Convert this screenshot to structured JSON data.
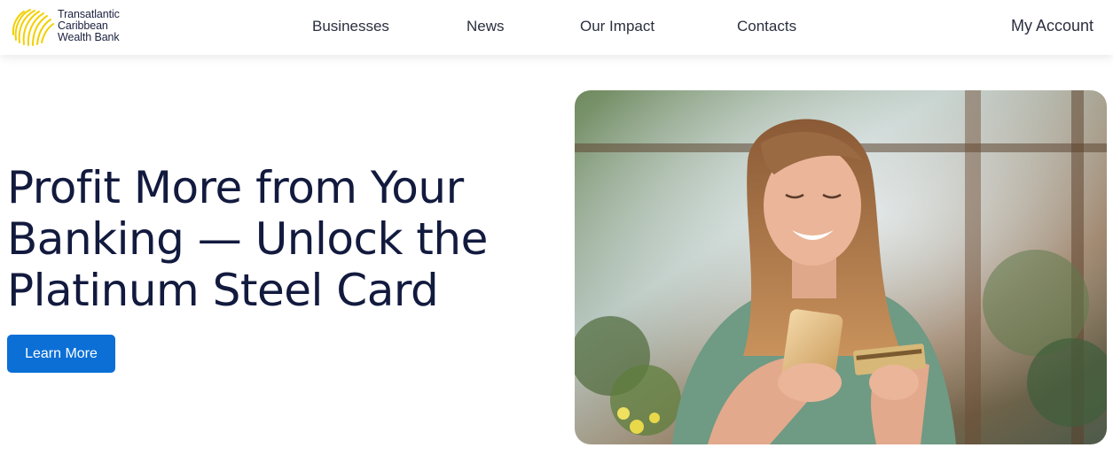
{
  "brand": {
    "name_line1": "Transatlantic",
    "name_line2": "Caribbean",
    "name_line3": "Wealth Bank",
    "logo_color": "#f2d000"
  },
  "nav": {
    "items": [
      {
        "label": "Businesses"
      },
      {
        "label": "News"
      },
      {
        "label": "Our Impact"
      },
      {
        "label": "Contacts"
      }
    ],
    "account_label": "My Account"
  },
  "hero": {
    "title_line1": "Profit More from Your",
    "title_line2": "Banking — Unlock the",
    "title_line3": "Platinum Steel Card",
    "cta_label": "Learn More",
    "cta_color": "#0b6fd6",
    "image_subject": "smiling woman holding smartphone and credit card in cafe"
  }
}
